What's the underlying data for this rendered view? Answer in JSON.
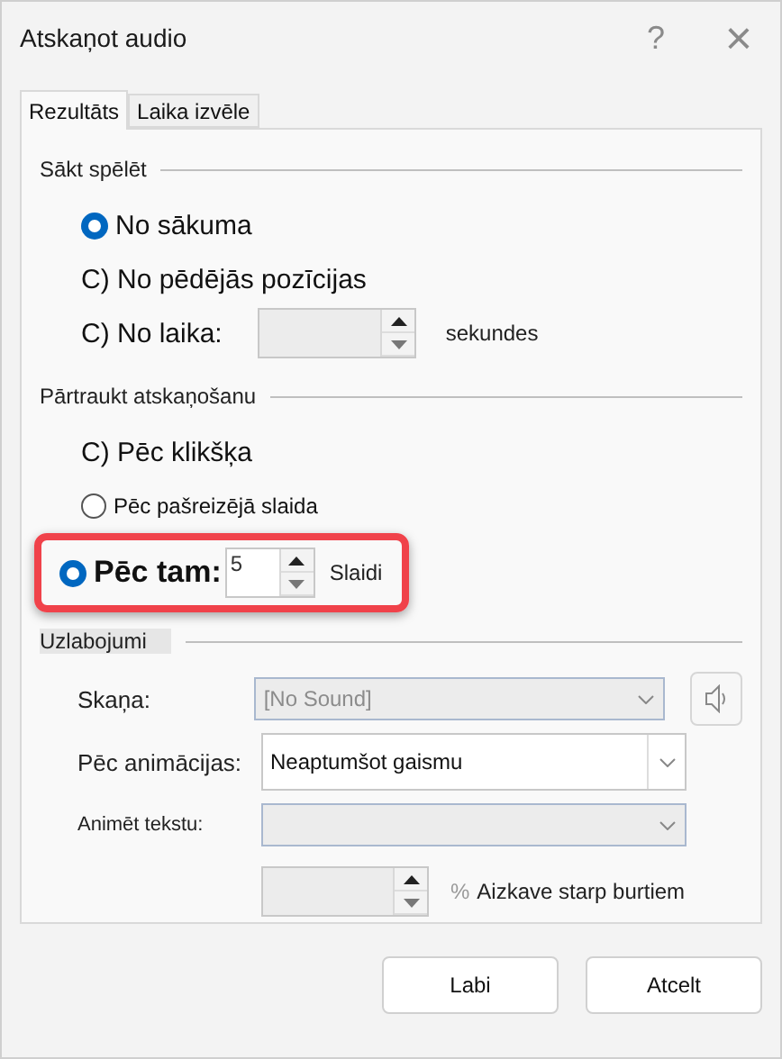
{
  "window": {
    "title": "Atskaņot audio",
    "help": "?",
    "close": "×"
  },
  "tabs": [
    {
      "label": "Rezultāts",
      "selected": true
    },
    {
      "label": "Laika izvēle",
      "selected": false
    }
  ],
  "sections": [
    {
      "title": "Sākt spēlēt",
      "options": [
        {
          "kind": "radio",
          "label": "No sākuma",
          "selected": true
        },
        {
          "kind": "plain",
          "label": "C) No pēdējās pozīcijas"
        },
        {
          "kind": "plain",
          "label": "C) No laika:",
          "spin": {
            "disabled": true
          },
          "unit": "sekundes"
        }
      ]
    },
    {
      "title": "Pārtraukt atskaņošanu",
      "options": [
        {
          "kind": "plain",
          "label": "C) Pēc klikšķa"
        },
        {
          "kind": "radio",
          "label": "Pēc pašreizējā slaida",
          "selected": false
        },
        {
          "kind": "radio",
          "label": "Pēc tam:",
          "selected": true,
          "highlighted": true,
          "spin": {
            "value": "5",
            "disabled": false
          },
          "unit": "Slaidi"
        }
      ]
    }
  ],
  "enhancements": {
    "title": "Uzlabojumi",
    "sound": {
      "label": "Skaņa:",
      "value": "[No Sound]",
      "disabled": true
    },
    "after_animation": {
      "label": "Pēc animācijas:",
      "value": "Neaptumšot gaismu",
      "disabled": false
    },
    "animate_text": {
      "label": "Animēt tekstu:",
      "disabled": true
    },
    "delay": {
      "percent": "%",
      "label": "Aizkave starp burtiem"
    }
  },
  "buttons": [
    "Labi",
    "Atcelt"
  ]
}
